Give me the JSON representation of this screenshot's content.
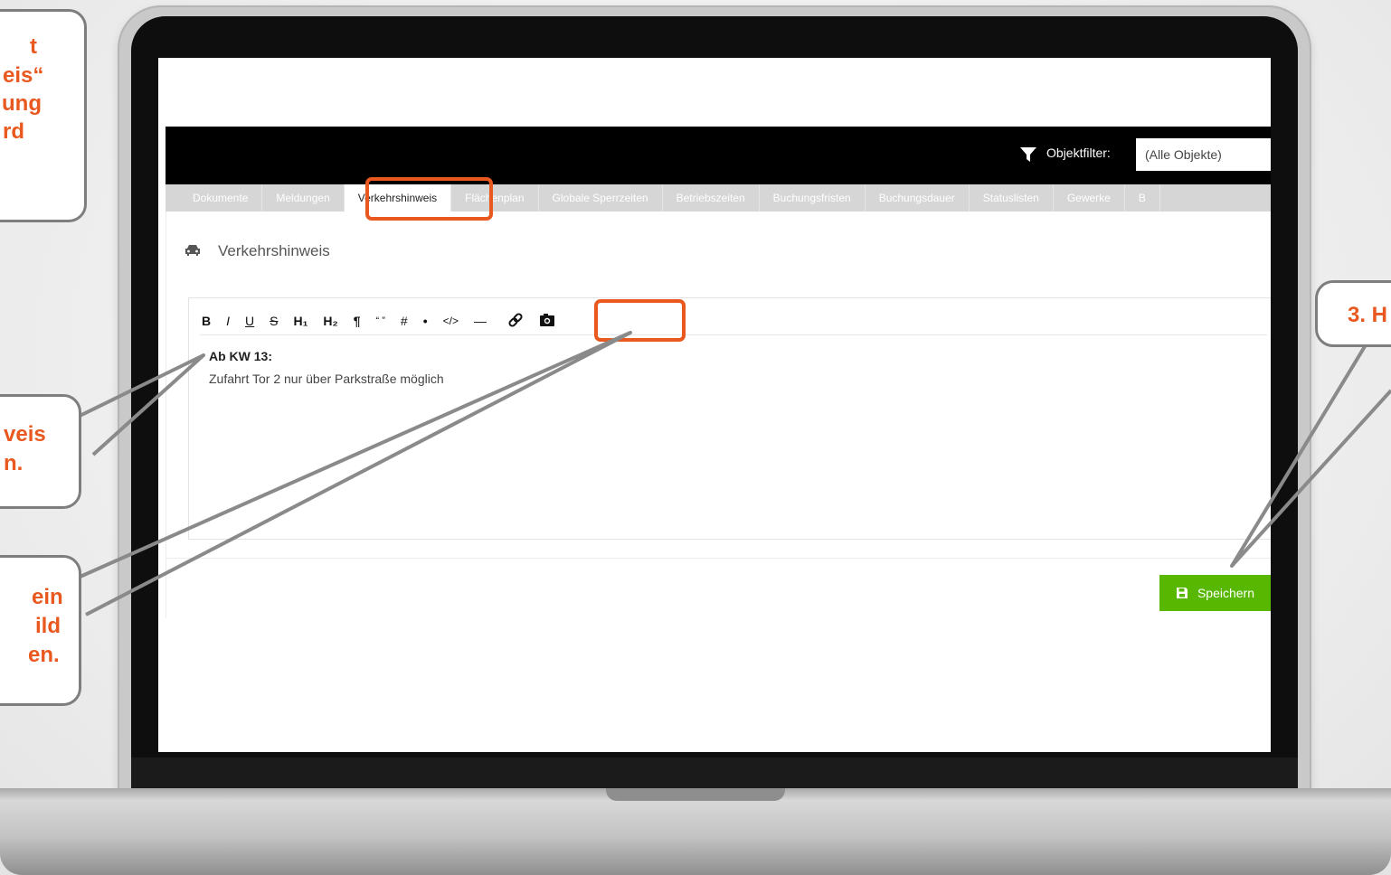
{
  "app": {
    "filter_label": "Objektfilter:",
    "filter_value": "(Alle Objekte)"
  },
  "tabs": [
    {
      "label": "Dokumente",
      "active": false
    },
    {
      "label": "Meldungen",
      "active": false
    },
    {
      "label": "Verkehrshinweis",
      "active": true
    },
    {
      "label": "Flächenplan",
      "active": false
    },
    {
      "label": "Globale Sperrzeiten",
      "active": false
    },
    {
      "label": "Betriebszeiten",
      "active": false
    },
    {
      "label": "Buchungsfristen",
      "active": false
    },
    {
      "label": "Buchungsdauer",
      "active": false
    },
    {
      "label": "Statuslisten",
      "active": false
    },
    {
      "label": "Gewerke",
      "active": false
    },
    {
      "label": "B",
      "active": false
    }
  ],
  "page": {
    "title": "Verkehrshinweis",
    "icon": "car-icon"
  },
  "editor": {
    "toolbar": [
      "B",
      "I",
      "U",
      "S",
      "H₁",
      "H₂",
      "¶",
      "“ ”",
      "#",
      "•",
      "</>",
      "—"
    ],
    "toolbar_icons": [
      "link-icon",
      "image-icon"
    ],
    "line1": "Ab KW 13:",
    "line2": "Zufahrt Tor 2 nur über Parkstraße möglich"
  },
  "save_button": {
    "label": "Speichern",
    "icon": "save-icon",
    "color": "#58b700"
  },
  "callouts": {
    "top_left": [
      "t",
      "eis“",
      "ung",
      "rd"
    ],
    "mid_left": [
      "veis",
      "n."
    ],
    "low_left": [
      "ein",
      "ild",
      "en."
    ],
    "right": "3. H"
  },
  "colors": {
    "accent": "#e8581f",
    "topbar": "#000000",
    "tabbar": "#d6d6d6"
  }
}
